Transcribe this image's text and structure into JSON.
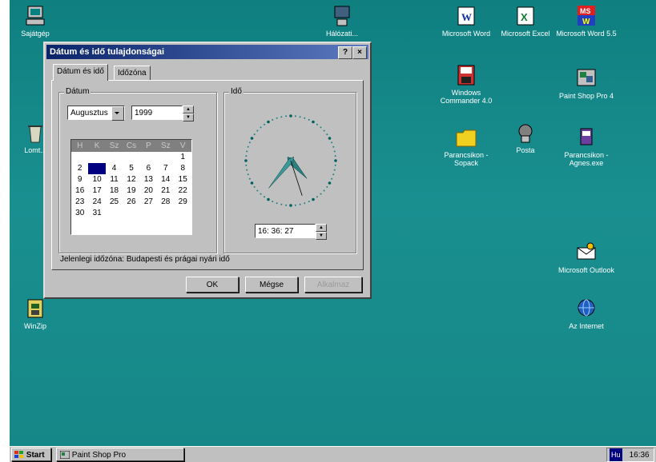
{
  "desktop": {
    "icons_left": [
      {
        "name": "my-computer-icon",
        "label": "Sajátgép"
      },
      {
        "name": "recycle-bin-icon",
        "label": "Lomt..."
      },
      {
        "name": "winzip-icon",
        "label": "WinZip"
      }
    ],
    "icons_middle": [
      {
        "name": "network-icon",
        "label": "Hálózati..."
      }
    ],
    "icons_right": [
      {
        "name": "word-icon",
        "label": "Microsoft Word"
      },
      {
        "name": "excel-icon",
        "label": "Microsoft Excel"
      },
      {
        "name": "word55-icon",
        "label": "Microsoft Word 5.5"
      },
      {
        "name": "windows-commander-icon",
        "label": "Windows Commander 4.0"
      },
      {
        "name": "paint-shop-pro-icon",
        "label": "Paint Shop Pro 4"
      },
      {
        "name": "folder-icon",
        "label": "Parancsikon - Sopack"
      },
      {
        "name": "mail-icon",
        "label": "Posta"
      },
      {
        "name": "shortcut-icon",
        "label": "Parancsikon - Agnes.exe"
      },
      {
        "name": "outlook-icon",
        "label": "Microsoft Outlook"
      },
      {
        "name": "internet-icon",
        "label": "Az Internet"
      }
    ]
  },
  "dialog": {
    "title": "Dátum és idő tulajdonságai",
    "help_btn": "?",
    "close_btn": "×",
    "tabs": [
      "Dátum és idő",
      "Időzóna"
    ],
    "date_group": "Dátum",
    "time_group": "Idő",
    "month": "Augusztus",
    "year": "1999",
    "weekdays": [
      "H",
      "K",
      "Sz",
      "Cs",
      "P",
      "Sz",
      "V"
    ],
    "weeks": [
      [
        "",
        "",
        "",
        "",
        "",
        "",
        "1"
      ],
      [
        "2",
        "3",
        "4",
        "5",
        "6",
        "7",
        "8"
      ],
      [
        "9",
        "10",
        "11",
        "12",
        "13",
        "14",
        "15"
      ],
      [
        "16",
        "17",
        "18",
        "19",
        "20",
        "21",
        "22"
      ],
      [
        "23",
        "24",
        "25",
        "26",
        "27",
        "28",
        "29"
      ],
      [
        "30",
        "31",
        "",
        "",
        "",
        "",
        ""
      ]
    ],
    "selected_day": "3",
    "time": "16: 36: 27",
    "timezone_text": "Jelenlegi időzóna: Budapesti és prágai nyári idő",
    "ok": "OK",
    "cancel": "Mégse",
    "apply": "Alkalmaz"
  },
  "taskbar": {
    "start": "Start",
    "task": "Paint Shop Pro",
    "lang": "Hu",
    "clock": "16:36"
  }
}
